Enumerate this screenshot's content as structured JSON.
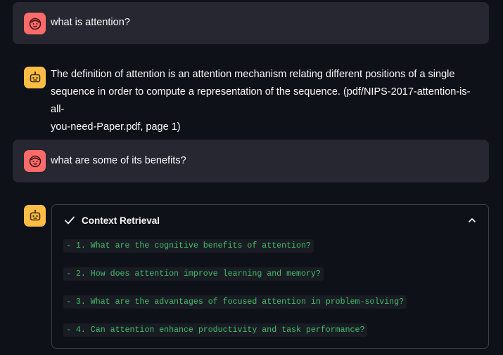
{
  "messages": [
    {
      "role": "user",
      "text": "what is attention?"
    },
    {
      "role": "assistant",
      "lines": [
        "The definition of attention is an attention mechanism relating different positions of a single",
        "sequence in order to compute a representation of the sequence. (pdf/NIPS-2017-attention-is-all-",
        "you-need-Paper.pdf, page 1)"
      ]
    },
    {
      "role": "user",
      "text": "what are some of its benefits?"
    }
  ],
  "expander": {
    "title": "Context Retrieval",
    "expanded": true,
    "lines": [
      "- 1. What are the cognitive benefits of attention?",
      "- 2. How does attention improve learning and memory?",
      "- 3. What are the advantages of focused attention in problem-solving?",
      "- 4. Can attention enhance productivity and task performance?"
    ]
  },
  "colors": {
    "background": "#0e1117",
    "user_bubble": "#262730",
    "user_avatar": "#ff6b6b",
    "assistant_avatar": "#ffbd45",
    "code_text": "#3fbf6a"
  },
  "icons": {
    "user_avatar": "user-face-icon",
    "assistant_avatar": "robot-icon",
    "expander_status": "check-icon",
    "expander_toggle": "chevron-up-icon"
  }
}
